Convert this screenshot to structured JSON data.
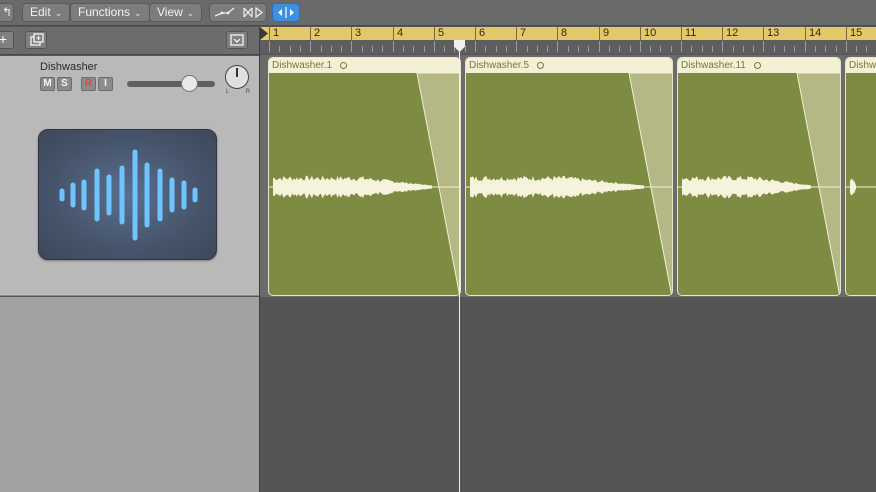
{
  "toolbar": {
    "edit_label": "Edit",
    "functions_label": "Functions",
    "view_label": "View"
  },
  "track": {
    "name": "Dishwasher",
    "mute": "M",
    "solo": "S",
    "record": "R",
    "input": "I",
    "pan_left": "L",
    "pan_right": "R",
    "volume_fraction": 0.7
  },
  "ruler": {
    "bars": [
      "1",
      "2",
      "3",
      "4",
      "5",
      "6",
      "7",
      "8",
      "9",
      "10",
      "11",
      "12",
      "13",
      "14",
      "15"
    ]
  },
  "regions": [
    {
      "name": "Dishwasher.1"
    },
    {
      "name": "Dishwasher.5"
    },
    {
      "name": "Dishwasher.11"
    },
    {
      "name": "Dishwasher"
    }
  ],
  "colors": {
    "region": "#7e8b42",
    "region_header": "#f3f0d6",
    "ruler": "#e3c86a",
    "accent": "#3d8fe0",
    "waveform_icon": "#6fc4ff"
  }
}
